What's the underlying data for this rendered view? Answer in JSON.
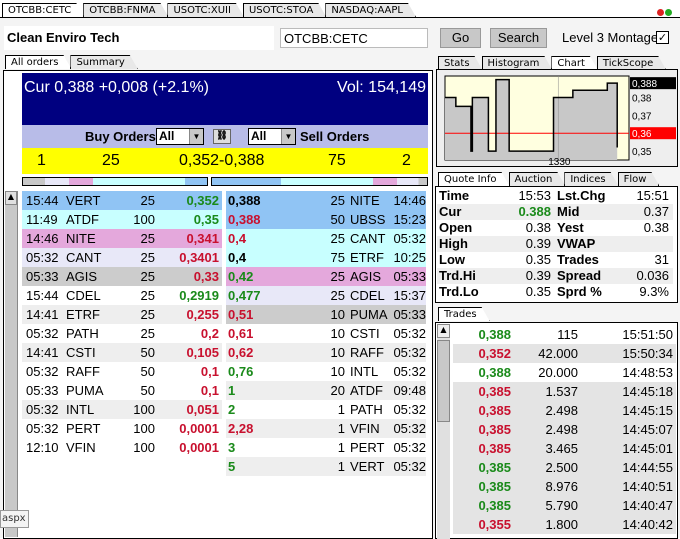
{
  "symbol_tabs": [
    "OTCBB:CETC",
    "OTCBB:FNMA",
    "USOTC:XUII",
    "USOTC:STOA",
    "NASDAQ:AAPL"
  ],
  "company": "Clean Enviro Tech",
  "symbol_input": "OTCBB:CETC",
  "go_label": "Go",
  "search_label": "Search",
  "level3_label": "Level 3 Montage",
  "level3_checked": true,
  "order_tabs": [
    "All orders",
    "Summary"
  ],
  "cur_line": "Cur 0,388 +0,008 (+2.1%)",
  "vol_line": "Vol: 154,149",
  "buy_orders_label": "Buy Orders",
  "sell_orders_label": "Sell Orders",
  "buy_filter": "All",
  "sell_filter": "All",
  "summary": {
    "buy_count": "1",
    "buy_size": "25",
    "spread": "0,352-0,388",
    "sell_size": "75",
    "sell_count": "2"
  },
  "buy_orders": [
    {
      "time": "15:44",
      "mm": "VERT",
      "size": "25",
      "price": "0,352",
      "c": "g",
      "bg": "#90c4f4"
    },
    {
      "time": "11:49",
      "mm": "ATDF",
      "size": "100",
      "price": "0,35",
      "c": "g",
      "bg": "#c8ffff"
    },
    {
      "time": "14:46",
      "mm": "NITE",
      "size": "25",
      "price": "0,341",
      "c": "r",
      "bg": "#e4a8dc"
    },
    {
      "time": "05:32",
      "mm": "CANT",
      "size": "25",
      "price": "0,3401",
      "c": "r",
      "bg": "#e8e8f8"
    },
    {
      "time": "05:33",
      "mm": "AGIS",
      "size": "25",
      "price": "0,33",
      "c": "r",
      "bg": "#cccccc"
    },
    {
      "time": "15:44",
      "mm": "CDEL",
      "size": "25",
      "price": "0,2919",
      "c": "g",
      "bg": "#ffffff"
    },
    {
      "time": "14:41",
      "mm": "ETRF",
      "size": "25",
      "price": "0,255",
      "c": "r",
      "bg": "#eeeeee"
    },
    {
      "time": "05:32",
      "mm": "PATH",
      "size": "25",
      "price": "0,2",
      "c": "r",
      "bg": "#ffffff"
    },
    {
      "time": "14:41",
      "mm": "CSTI",
      "size": "50",
      "price": "0,105",
      "c": "r",
      "bg": "#eeeeee"
    },
    {
      "time": "05:32",
      "mm": "RAFF",
      "size": "50",
      "price": "0,1",
      "c": "r",
      "bg": "#ffffff"
    },
    {
      "time": "05:33",
      "mm": "PUMA",
      "size": "50",
      "price": "0,1",
      "c": "r",
      "bg": "#ffffff"
    },
    {
      "time": "05:32",
      "mm": "INTL",
      "size": "100",
      "price": "0,051",
      "c": "r",
      "bg": "#eeeeee"
    },
    {
      "time": "05:32",
      "mm": "PERT",
      "size": "100",
      "price": "0,0001",
      "c": "r",
      "bg": "#ffffff"
    },
    {
      "time": "12:10",
      "mm": "VFIN",
      "size": "100",
      "price": "0,0001",
      "c": "r",
      "bg": "#ffffff"
    }
  ],
  "sell_orders": [
    {
      "price": "0,388",
      "size": "25",
      "mm": "NITE",
      "time": "14:46",
      "c": "k",
      "bg": "#90c4f4"
    },
    {
      "price": "0,388",
      "size": "50",
      "mm": "UBSS",
      "time": "15:23",
      "c": "r",
      "bg": "#90c4f4"
    },
    {
      "price": "0,4",
      "size": "25",
      "mm": "CANT",
      "time": "05:32",
      "c": "r",
      "bg": "#c8ffff"
    },
    {
      "price": "0,4",
      "size": "75",
      "mm": "ETRF",
      "time": "10:25",
      "c": "k",
      "bg": "#c8ffff"
    },
    {
      "price": "0,42",
      "size": "25",
      "mm": "AGIS",
      "time": "05:33",
      "c": "g",
      "bg": "#e4a8dc"
    },
    {
      "price": "0,477",
      "size": "25",
      "mm": "CDEL",
      "time": "15:37",
      "c": "g",
      "bg": "#e8e8f8"
    },
    {
      "price": "0,51",
      "size": "10",
      "mm": "PUMA",
      "time": "05:33",
      "c": "r",
      "bg": "#cccccc"
    },
    {
      "price": "0,61",
      "size": "10",
      "mm": "CSTI",
      "time": "05:32",
      "c": "r",
      "bg": "#ffffff"
    },
    {
      "price": "0,62",
      "size": "10",
      "mm": "RAFF",
      "time": "05:32",
      "c": "r",
      "bg": "#eeeeee"
    },
    {
      "price": "0,76",
      "size": "10",
      "mm": "INTL",
      "time": "05:32",
      "c": "g",
      "bg": "#ffffff"
    },
    {
      "price": "1",
      "size": "20",
      "mm": "ATDF",
      "time": "09:48",
      "c": "g",
      "bg": "#eeeeee"
    },
    {
      "price": "2",
      "size": "1",
      "mm": "PATH",
      "time": "05:32",
      "c": "g",
      "bg": "#ffffff"
    },
    {
      "price": "2,28",
      "size": "1",
      "mm": "VFIN",
      "time": "05:32",
      "c": "r",
      "bg": "#eeeeee"
    },
    {
      "price": "3",
      "size": "1",
      "mm": "PERT",
      "time": "05:32",
      "c": "g",
      "bg": "#ffffff"
    },
    {
      "price": "5",
      "size": "1",
      "mm": "VERT",
      "time": "05:32",
      "c": "g",
      "bg": "#eeeeee"
    }
  ],
  "chart_tabs": [
    "Stats",
    "Histogram",
    "Chart",
    "TickScope"
  ],
  "chart_data": {
    "type": "line",
    "step": true,
    "x_tick_labels": [
      "1330"
    ],
    "xlim": [
      "09:30",
      "16:00"
    ],
    "ylim": [
      0.345,
      0.392
    ],
    "y_tick_labels": [
      "0,38",
      "0,37",
      "0,35"
    ],
    "current_label": "0,388",
    "reference_label": "0,36",
    "reference_value": 0.36,
    "points": [
      [
        "09:30",
        0.38
      ],
      [
        "09:53",
        0.375
      ],
      [
        "10:25",
        0.35
      ],
      [
        "10:28",
        0.38
      ],
      [
        "11:02",
        0.35
      ],
      [
        "11:18",
        0.39
      ],
      [
        "11:46",
        0.35
      ],
      [
        "13:20",
        0.38
      ],
      [
        "14:01",
        0.384
      ],
      [
        "15:14",
        0.388
      ],
      [
        "15:35",
        0.352
      ]
    ],
    "colors": {
      "line": "#000000",
      "fill": "#c8c8c8",
      "bg": "#ffffe0",
      "reference": "#ff0000",
      "current_bg": "#000000"
    }
  },
  "quote_tabs": [
    "Quote Info",
    "Auction",
    "Indices",
    "Flow"
  ],
  "quote": [
    [
      "Time",
      "15:53",
      "Lst.Chg",
      "15:51"
    ],
    [
      "Cur",
      "0.388",
      "Mid",
      "0.37"
    ],
    [
      "Open",
      "0.38",
      "Yest",
      "0.38"
    ],
    [
      "High",
      "0.39",
      "VWAP",
      ""
    ],
    [
      "Low",
      "0.35",
      "Trades",
      "31"
    ],
    [
      "Trd.Hi",
      "0.39",
      "Spread",
      "0.036"
    ],
    [
      "Trd.Lo",
      "0.35",
      "Sprd %",
      "9.3%"
    ]
  ],
  "trades_tab": "Trades",
  "trades": [
    {
      "price": "0,388",
      "size": "115",
      "time": "15:51:50",
      "c": "g"
    },
    {
      "price": "0,352",
      "size": "42.000",
      "time": "15:50:34",
      "c": "r"
    },
    {
      "price": "0,388",
      "size": "20.000",
      "time": "14:48:53",
      "c": "g"
    },
    {
      "price": "0,385",
      "size": "1.537",
      "time": "14:45:18",
      "c": "r"
    },
    {
      "price": "0,385",
      "size": "2.498",
      "time": "14:45:15",
      "c": "r"
    },
    {
      "price": "0,385",
      "size": "2.498",
      "time": "14:45:07",
      "c": "r"
    },
    {
      "price": "0,385",
      "size": "3.465",
      "time": "14:45:01",
      "c": "r"
    },
    {
      "price": "0,385",
      "size": "2.500",
      "time": "14:44:55",
      "c": "g"
    },
    {
      "price": "0,385",
      "size": "8.976",
      "time": "14:40:51",
      "c": "g"
    },
    {
      "price": "0,385",
      "size": "5.790",
      "time": "14:40:47",
      "c": "g"
    },
    {
      "price": "0,355",
      "size": "1.800",
      "time": "14:40:42",
      "c": "r"
    }
  ],
  "status_tooltip": "aspx"
}
